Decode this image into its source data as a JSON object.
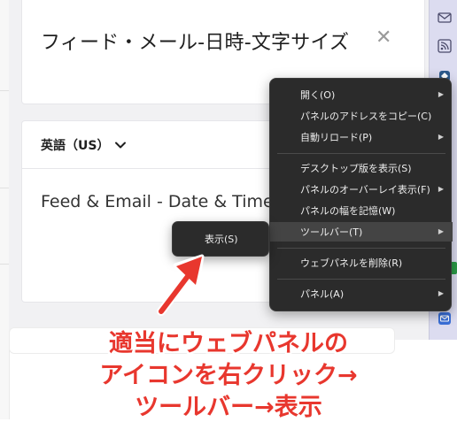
{
  "feed_card": {
    "title": "フィード・メール-日時-文字サイズ",
    "close_glyph": "✕"
  },
  "language_select": {
    "value": "英語（US）"
  },
  "preview": {
    "text": "Feed & Email - Date & Time"
  },
  "context_menu": {
    "items": [
      {
        "label": "開く(O)",
        "has_submenu": true
      },
      {
        "label": "パネルのアドレスをコピー(C)",
        "has_submenu": false
      },
      {
        "label": "自動リロード(P)",
        "has_submenu": true
      },
      {
        "label": "デスクトップ版を表示(S)",
        "has_submenu": false
      },
      {
        "label": "パネルのオーバーレイ表示(F)",
        "has_submenu": true
      },
      {
        "label": "パネルの幅を記憶(W)",
        "has_submenu": false
      },
      {
        "label": "ツールバー(T)",
        "has_submenu": true,
        "highlighted": true
      },
      {
        "label": "ウェブパネルを削除(R)",
        "has_submenu": false
      },
      {
        "label": "パネル(A)",
        "has_submenu": true
      }
    ],
    "submenu_arrow": "▶"
  },
  "toolbar_submenu": {
    "items": [
      {
        "label": "表示(S)"
      }
    ]
  },
  "annotation": {
    "lines": [
      "適当にウェブパネルの",
      "アイコンを右クリック→",
      "ツールバー→表示"
    ],
    "color": "#e8372e"
  },
  "sidebar": {
    "icons": [
      "mail-icon",
      "rss-icon",
      "web-panel-icon",
      "panel-icon",
      "mail-panel-icon"
    ]
  }
}
